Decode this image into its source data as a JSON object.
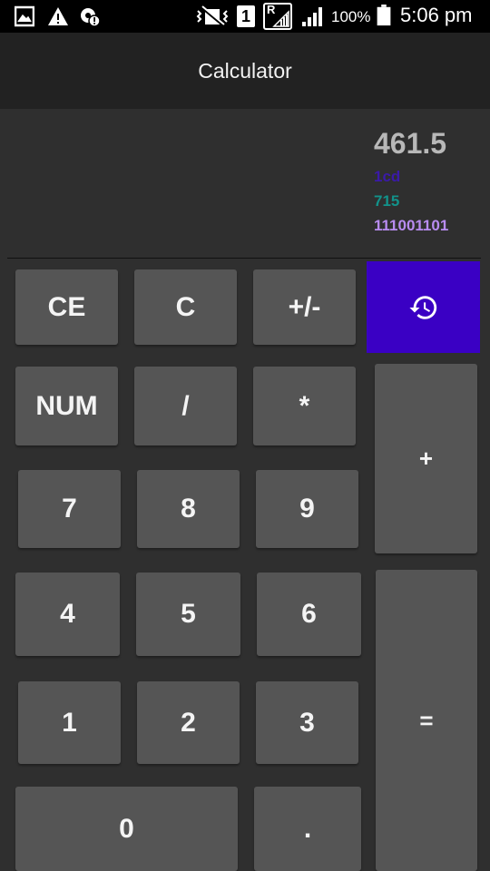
{
  "status_bar": {
    "signal_label": "R",
    "sim_slot": "1",
    "battery_percent": "100%",
    "time": "5:06 pm"
  },
  "app": {
    "title": "Calculator"
  },
  "display": {
    "result": "461.5",
    "hex": "1cd",
    "octal": "715",
    "binary": "111001101",
    "colors": {
      "result": "#b8b8b8",
      "hex": "#3a1aa8",
      "octal": "#12928a",
      "binary": "#b88cf0"
    }
  },
  "keys": {
    "ce": "CE",
    "c": "C",
    "sign": "+/-",
    "num": "NUM",
    "divide": "/",
    "multiply": "*",
    "plus": "+",
    "seven": "7",
    "eight": "8",
    "nine": "9",
    "four": "4",
    "five": "5",
    "six": "6",
    "one": "1",
    "two": "2",
    "three": "3",
    "equals": "=",
    "zero": "0",
    "dot": "."
  },
  "icons": {
    "history": "history-icon"
  },
  "theme": {
    "accent": "#3a00c4",
    "key_bg": "#555555",
    "background": "#2f2f2f",
    "appbar": "#222222"
  }
}
